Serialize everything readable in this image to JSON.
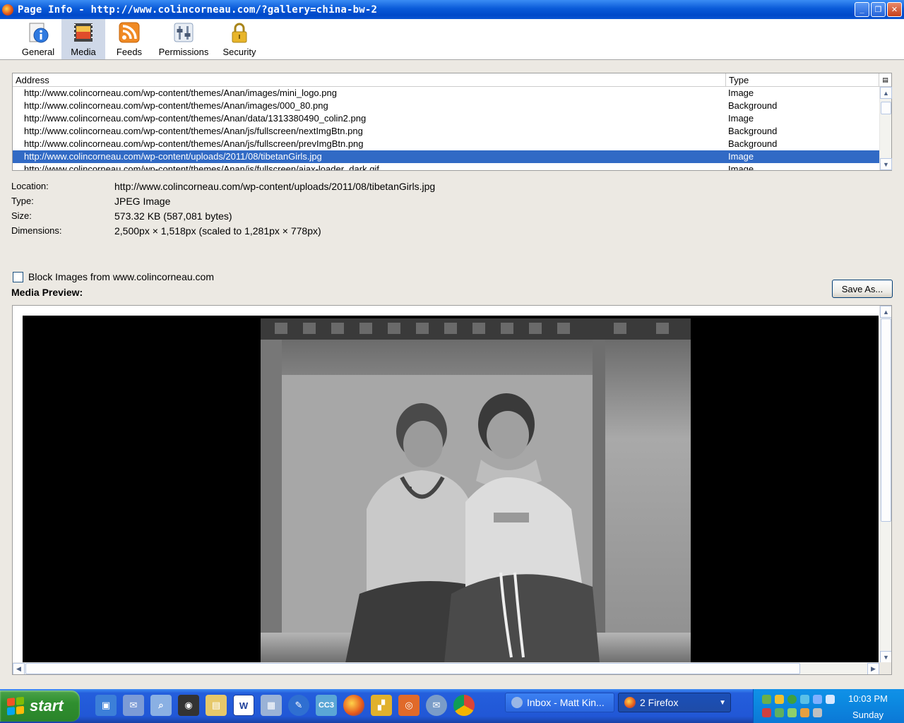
{
  "window": {
    "title": "Page Info - http://www.colincorneau.com/?gallery=china-bw-2",
    "minimize": "_",
    "restore": "❐",
    "close": "✕"
  },
  "toolbar": {
    "tabs": [
      {
        "label": "General",
        "icon": "info-icon",
        "active": false
      },
      {
        "label": "Media",
        "icon": "media-icon",
        "active": true
      },
      {
        "label": "Feeds",
        "icon": "rss-icon",
        "active": false
      },
      {
        "label": "Permissions",
        "icon": "permissions-icon",
        "active": false
      },
      {
        "label": "Security",
        "icon": "lock-icon",
        "active": false
      }
    ]
  },
  "media_list": {
    "columns": [
      "Address",
      "Type"
    ],
    "rows": [
      {
        "address": "http://www.colincorneau.com/wp-content/themes/Anan/images/mini_logo.png",
        "type": "Image"
      },
      {
        "address": "http://www.colincorneau.com/wp-content/themes/Anan/images/000_80.png",
        "type": "Background"
      },
      {
        "address": "http://www.colincorneau.com/wp-content/themes/Anan/data/1313380490_colin2.png",
        "type": "Image"
      },
      {
        "address": "http://www.colincorneau.com/wp-content/themes/Anan/js/fullscreen/nextImgBtn.png",
        "type": "Background"
      },
      {
        "address": "http://www.colincorneau.com/wp-content/themes/Anan/js/fullscreen/prevImgBtn.png",
        "type": "Background"
      },
      {
        "address": "http://www.colincorneau.com/wp-content/uploads/2011/08/tibetanGirls.jpg",
        "type": "Image",
        "selected": true
      },
      {
        "address": "http://www.colincorneau.com/wp-content/themes/Anan/js/fullscreen/ajax-loader_dark.gif",
        "type": "Image"
      }
    ]
  },
  "details": {
    "location_label": "Location:",
    "location": "http://www.colincorneau.com/wp-content/uploads/2011/08/tibetanGirls.jpg",
    "type_label": "Type:",
    "type": "JPEG Image",
    "size_label": "Size:",
    "size": "573.32 KB (587,081 bytes)",
    "dimensions_label": "Dimensions:",
    "dimensions": "2,500px × 1,518px (scaled to 1,281px × 778px)"
  },
  "block_images": {
    "label": "Block Images from www.colincorneau.com",
    "checked": false
  },
  "preview": {
    "label": "Media Preview:",
    "save_as": "Save As..."
  },
  "taskbar": {
    "start_label": "start",
    "tasks": [
      {
        "label": "Inbox - Matt Kin...",
        "active": false
      },
      {
        "label": "2 Firefox",
        "active": true
      }
    ],
    "clock_time": "10:03 PM",
    "clock_day": "Sunday",
    "quicklaunch_cc3": "CC3",
    "quicklaunch_word": "W"
  }
}
